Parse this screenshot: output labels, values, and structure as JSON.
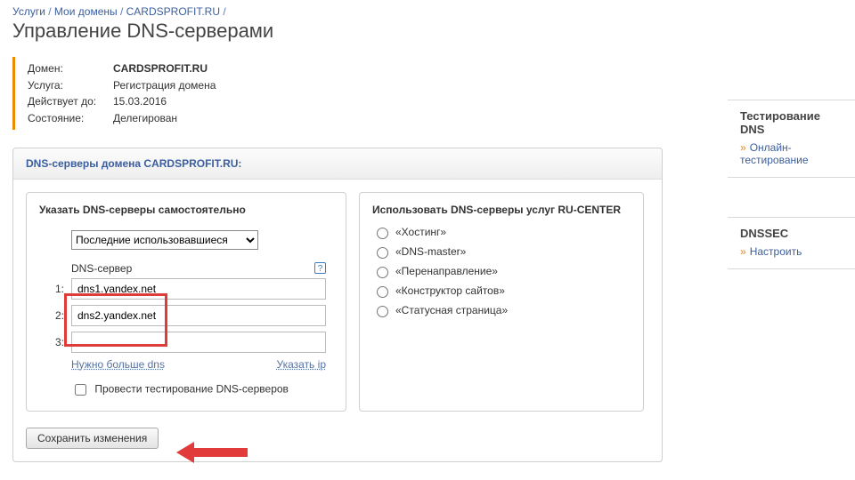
{
  "breadcrumb": {
    "a": "Услуги",
    "b": "Мои домены",
    "c": "CARDSPROFIT.RU"
  },
  "page_title": "Управление DNS-серверами",
  "info": {
    "domain_label": "Домен:",
    "domain_value": "CARDSPROFIT.RU",
    "service_label": "Услуга:",
    "service_value": "Регистрация домена",
    "until_label": "Действует до:",
    "until_value": "15.03.2016",
    "state_label": "Состояние:",
    "state_value": "Делегирован"
  },
  "box_header": "DNS-серверы домена CARDSPROFIT.RU:",
  "left_panel": {
    "title": "Указать DNS-серверы самостоятельно",
    "history_option": "Последние использовавшиеся",
    "dns_label": "DNS-сервер",
    "rows": {
      "n1": "1:",
      "n2": "2:",
      "n3": "3:"
    },
    "values": {
      "v1": "dns1.yandex.net",
      "v2": "dns2.yandex.net",
      "v3": ""
    },
    "more_link": "Нужно больше dns",
    "ip_link": "Указать ip",
    "test_label": "Провести тестирование DNS-серверов",
    "help": "?"
  },
  "right_panel": {
    "title": "Использовать DNS-серверы услуг RU-CENTER",
    "options": {
      "o1": "«Хостинг»",
      "o2": "«DNS-master»",
      "o3": "«Перенаправление»",
      "o4": "«Конструктор сайтов»",
      "o5": "«Статусная страница»"
    }
  },
  "save_button": "Сохранить изменения",
  "sidebar": {
    "card1_title": "Тестирование DNS",
    "card1_link": "Онлайн-тестирование",
    "card2_title": "DNSSEC",
    "card2_link": "Настроить"
  }
}
